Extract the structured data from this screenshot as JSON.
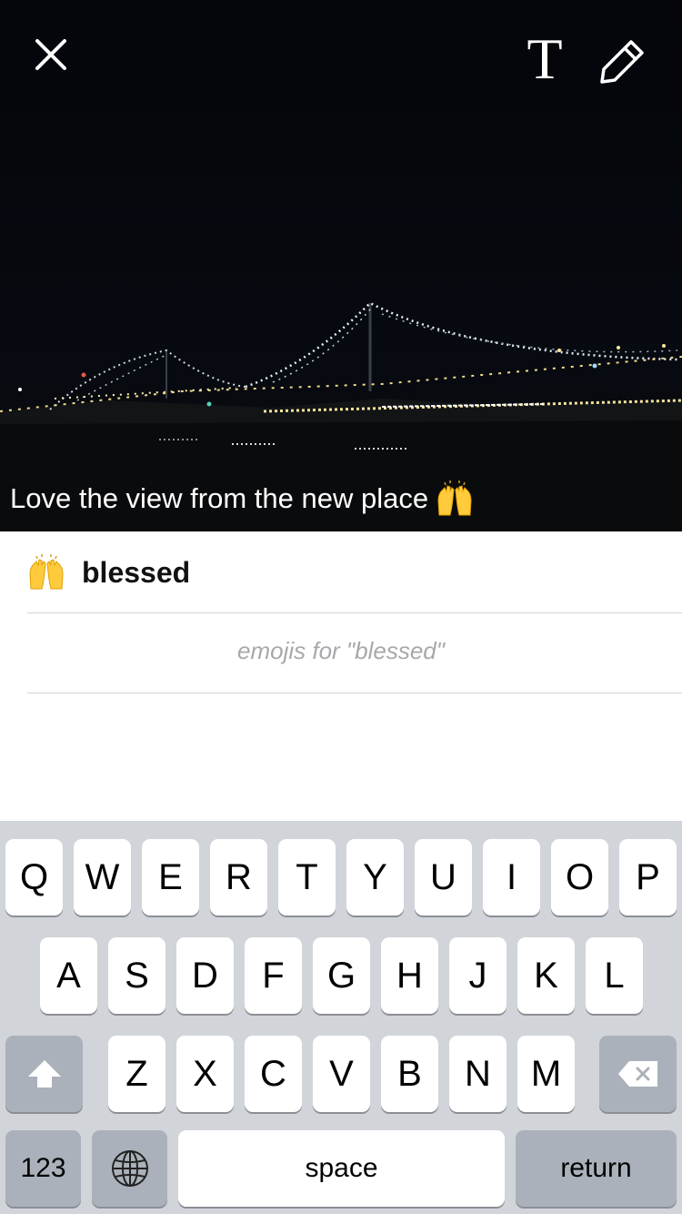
{
  "photo": {
    "close_icon": "close-icon",
    "text_tool_label": "T",
    "draw_icon": "pencil-icon",
    "caption_text": "Love the view from the new place",
    "caption_emoji": "raising-hands-emoji"
  },
  "suggestions": {
    "item_emoji": "raising-hands-emoji",
    "item_label": "blessed",
    "hint": "emojis for \"blessed\""
  },
  "keyboard": {
    "row1": [
      "Q",
      "W",
      "E",
      "R",
      "T",
      "Y",
      "U",
      "I",
      "O",
      "P"
    ],
    "row2": [
      "A",
      "S",
      "D",
      "F",
      "G",
      "H",
      "J",
      "K",
      "L"
    ],
    "row3": [
      "Z",
      "X",
      "C",
      "V",
      "B",
      "N",
      "M"
    ],
    "shift_icon": "shift-arrow-icon",
    "delete_icon": "backspace-icon",
    "numbers_label": "123",
    "globe_icon": "globe-icon",
    "space_label": "space",
    "return_label": "return"
  }
}
